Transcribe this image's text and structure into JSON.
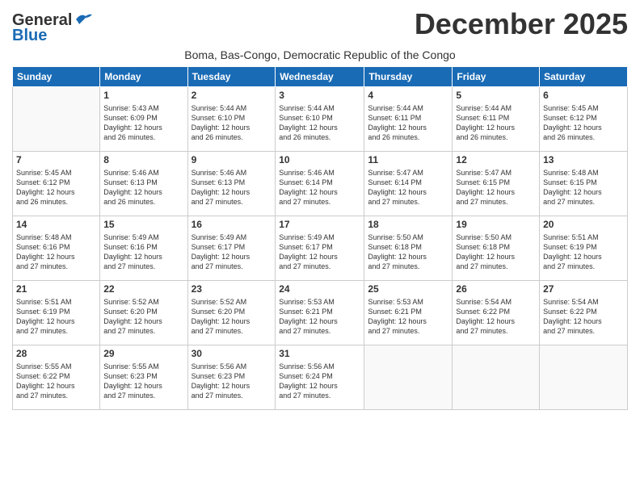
{
  "logo": {
    "general": "General",
    "blue": "Blue"
  },
  "title": "December 2025",
  "location": "Boma, Bas-Congo, Democratic Republic of the Congo",
  "days_header": [
    "Sunday",
    "Monday",
    "Tuesday",
    "Wednesday",
    "Thursday",
    "Friday",
    "Saturday"
  ],
  "weeks": [
    [
      {
        "day": "",
        "info": ""
      },
      {
        "day": "1",
        "info": "Sunrise: 5:43 AM\nSunset: 6:09 PM\nDaylight: 12 hours\nand 26 minutes."
      },
      {
        "day": "2",
        "info": "Sunrise: 5:44 AM\nSunset: 6:10 PM\nDaylight: 12 hours\nand 26 minutes."
      },
      {
        "day": "3",
        "info": "Sunrise: 5:44 AM\nSunset: 6:10 PM\nDaylight: 12 hours\nand 26 minutes."
      },
      {
        "day": "4",
        "info": "Sunrise: 5:44 AM\nSunset: 6:11 PM\nDaylight: 12 hours\nand 26 minutes."
      },
      {
        "day": "5",
        "info": "Sunrise: 5:44 AM\nSunset: 6:11 PM\nDaylight: 12 hours\nand 26 minutes."
      },
      {
        "day": "6",
        "info": "Sunrise: 5:45 AM\nSunset: 6:12 PM\nDaylight: 12 hours\nand 26 minutes."
      }
    ],
    [
      {
        "day": "7",
        "info": "Sunrise: 5:45 AM\nSunset: 6:12 PM\nDaylight: 12 hours\nand 26 minutes."
      },
      {
        "day": "8",
        "info": "Sunrise: 5:46 AM\nSunset: 6:13 PM\nDaylight: 12 hours\nand 26 minutes."
      },
      {
        "day": "9",
        "info": "Sunrise: 5:46 AM\nSunset: 6:13 PM\nDaylight: 12 hours\nand 27 minutes."
      },
      {
        "day": "10",
        "info": "Sunrise: 5:46 AM\nSunset: 6:14 PM\nDaylight: 12 hours\nand 27 minutes."
      },
      {
        "day": "11",
        "info": "Sunrise: 5:47 AM\nSunset: 6:14 PM\nDaylight: 12 hours\nand 27 minutes."
      },
      {
        "day": "12",
        "info": "Sunrise: 5:47 AM\nSunset: 6:15 PM\nDaylight: 12 hours\nand 27 minutes."
      },
      {
        "day": "13",
        "info": "Sunrise: 5:48 AM\nSunset: 6:15 PM\nDaylight: 12 hours\nand 27 minutes."
      }
    ],
    [
      {
        "day": "14",
        "info": "Sunrise: 5:48 AM\nSunset: 6:16 PM\nDaylight: 12 hours\nand 27 minutes."
      },
      {
        "day": "15",
        "info": "Sunrise: 5:49 AM\nSunset: 6:16 PM\nDaylight: 12 hours\nand 27 minutes."
      },
      {
        "day": "16",
        "info": "Sunrise: 5:49 AM\nSunset: 6:17 PM\nDaylight: 12 hours\nand 27 minutes."
      },
      {
        "day": "17",
        "info": "Sunrise: 5:49 AM\nSunset: 6:17 PM\nDaylight: 12 hours\nand 27 minutes."
      },
      {
        "day": "18",
        "info": "Sunrise: 5:50 AM\nSunset: 6:18 PM\nDaylight: 12 hours\nand 27 minutes."
      },
      {
        "day": "19",
        "info": "Sunrise: 5:50 AM\nSunset: 6:18 PM\nDaylight: 12 hours\nand 27 minutes."
      },
      {
        "day": "20",
        "info": "Sunrise: 5:51 AM\nSunset: 6:19 PM\nDaylight: 12 hours\nand 27 minutes."
      }
    ],
    [
      {
        "day": "21",
        "info": "Sunrise: 5:51 AM\nSunset: 6:19 PM\nDaylight: 12 hours\nand 27 minutes."
      },
      {
        "day": "22",
        "info": "Sunrise: 5:52 AM\nSunset: 6:20 PM\nDaylight: 12 hours\nand 27 minutes."
      },
      {
        "day": "23",
        "info": "Sunrise: 5:52 AM\nSunset: 6:20 PM\nDaylight: 12 hours\nand 27 minutes."
      },
      {
        "day": "24",
        "info": "Sunrise: 5:53 AM\nSunset: 6:21 PM\nDaylight: 12 hours\nand 27 minutes."
      },
      {
        "day": "25",
        "info": "Sunrise: 5:53 AM\nSunset: 6:21 PM\nDaylight: 12 hours\nand 27 minutes."
      },
      {
        "day": "26",
        "info": "Sunrise: 5:54 AM\nSunset: 6:22 PM\nDaylight: 12 hours\nand 27 minutes."
      },
      {
        "day": "27",
        "info": "Sunrise: 5:54 AM\nSunset: 6:22 PM\nDaylight: 12 hours\nand 27 minutes."
      }
    ],
    [
      {
        "day": "28",
        "info": "Sunrise: 5:55 AM\nSunset: 6:22 PM\nDaylight: 12 hours\nand 27 minutes."
      },
      {
        "day": "29",
        "info": "Sunrise: 5:55 AM\nSunset: 6:23 PM\nDaylight: 12 hours\nand 27 minutes."
      },
      {
        "day": "30",
        "info": "Sunrise: 5:56 AM\nSunset: 6:23 PM\nDaylight: 12 hours\nand 27 minutes."
      },
      {
        "day": "31",
        "info": "Sunrise: 5:56 AM\nSunset: 6:24 PM\nDaylight: 12 hours\nand 27 minutes."
      },
      {
        "day": "",
        "info": ""
      },
      {
        "day": "",
        "info": ""
      },
      {
        "day": "",
        "info": ""
      }
    ]
  ]
}
